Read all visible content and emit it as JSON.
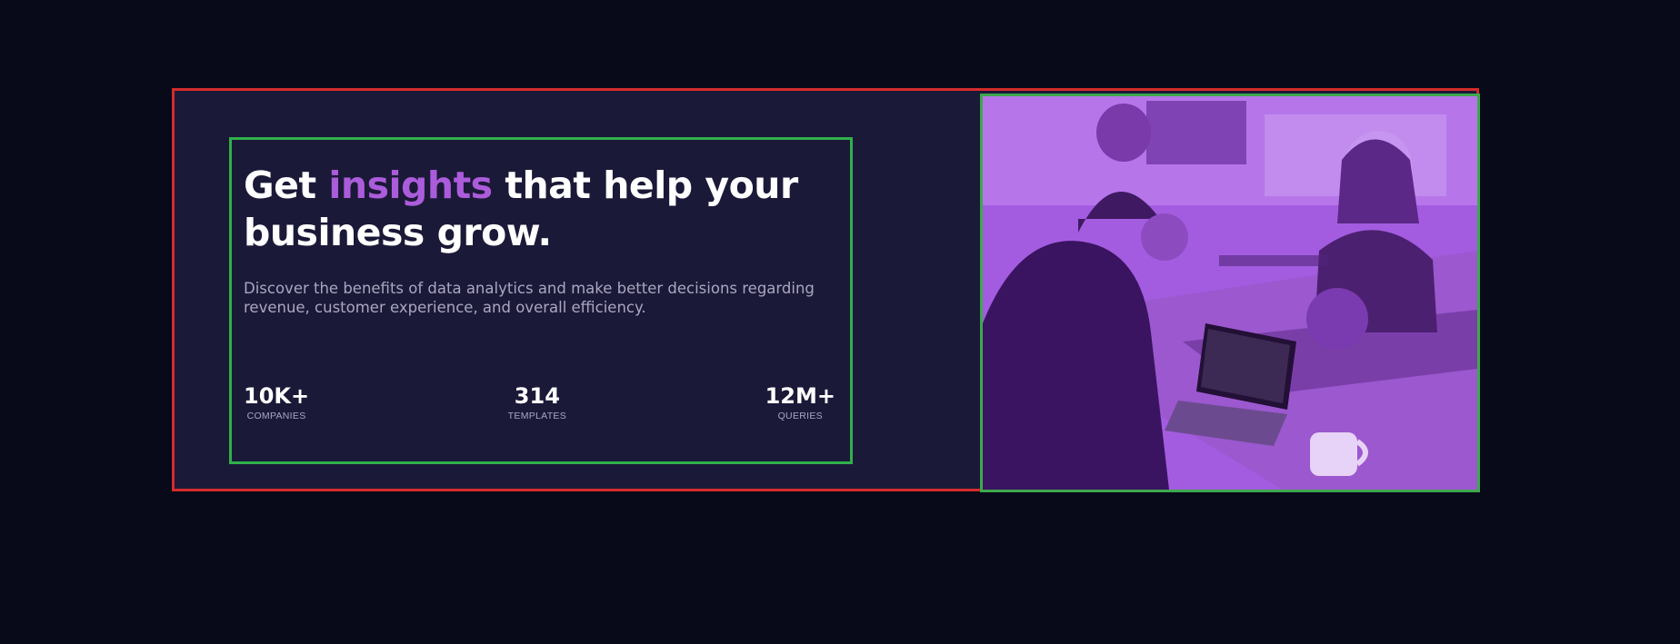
{
  "hero": {
    "headline_prefix": "Get ",
    "headline_accent": "insights",
    "headline_suffix": " that help your business grow.",
    "description": "Discover the benefits of data analytics and make better decisions regarding revenue, customer experience, and overall efficiency."
  },
  "stats": [
    {
      "value": "10K+",
      "label": "COMPANIES"
    },
    {
      "value": "314",
      "label": "TEMPLATES"
    },
    {
      "value": "12M+",
      "label": "QUERIES"
    }
  ],
  "image": {
    "subject": "team-collaborating-photo",
    "tint": "#a35ce0"
  },
  "colors": {
    "page_background": "#080a19",
    "card_background": "#1b1938",
    "accent": "#ab5cdb",
    "muted_text": "#a9a7bf"
  }
}
